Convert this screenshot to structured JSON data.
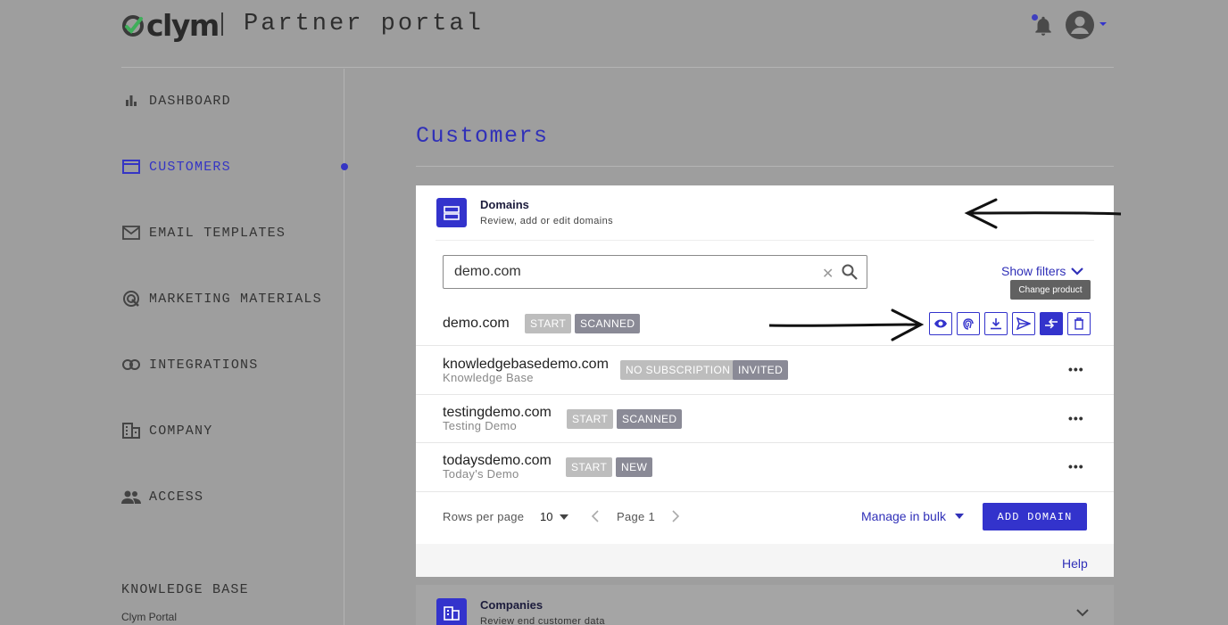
{
  "header": {
    "brand": "clym",
    "portal_title": "Partner portal"
  },
  "sidebar": {
    "items": [
      {
        "label": "DASHBOARD",
        "icon": "bar-chart-icon"
      },
      {
        "label": "CUSTOMERS",
        "icon": "folder-icon",
        "active": true
      },
      {
        "label": "EMAIL TEMPLATES",
        "icon": "mail-icon"
      },
      {
        "label": "MARKETING MATERIALS",
        "icon": "target-icon"
      },
      {
        "label": "INTEGRATIONS",
        "icon": "link-icon"
      },
      {
        "label": "COMPANY",
        "icon": "building-icon"
      },
      {
        "label": "ACCESS",
        "icon": "people-icon"
      }
    ],
    "knowledge_base": {
      "title": "KNOWLEDGE BASE",
      "link": "Clym Portal"
    }
  },
  "main": {
    "title": "Customers",
    "domains_card": {
      "title": "Domains",
      "subtitle": "Review, add or edit domains",
      "search_value": "demo.com",
      "show_filters": "Show filters",
      "tooltip": "Change product",
      "rows": [
        {
          "domain": "demo.com",
          "subname": "",
          "badges": [
            "START",
            "SCANNED"
          ]
        },
        {
          "domain": "knowledgebasedemo.com",
          "subname": "Knowledge Base",
          "badges": [
            "NO SUBSCRIPTION",
            "INVITED"
          ]
        },
        {
          "domain": "testingdemo.com",
          "subname": "Testing Demo",
          "badges": [
            "START",
            "SCANNED"
          ]
        },
        {
          "domain": "todaysdemo.com",
          "subname": "Today's Demo",
          "badges": [
            "START",
            "NEW"
          ]
        }
      ],
      "row_actions": [
        "eye-icon",
        "fingerprint-icon",
        "download-icon",
        "send-icon",
        "change-product-icon",
        "trash-icon"
      ],
      "more_label": "•••",
      "footer": {
        "rows_per_page_label": "Rows per page",
        "rows_per_page_value": "10",
        "page_label": "Page 1",
        "manage_bulk": "Manage in bulk",
        "add_domain": "ADD DOMAIN",
        "help": "Help"
      }
    },
    "companies_card": {
      "title": "Companies",
      "subtitle": "Review end customer data"
    }
  },
  "colors": {
    "accent": "#3333cc",
    "overlay_gray": "#9e9e9e"
  }
}
